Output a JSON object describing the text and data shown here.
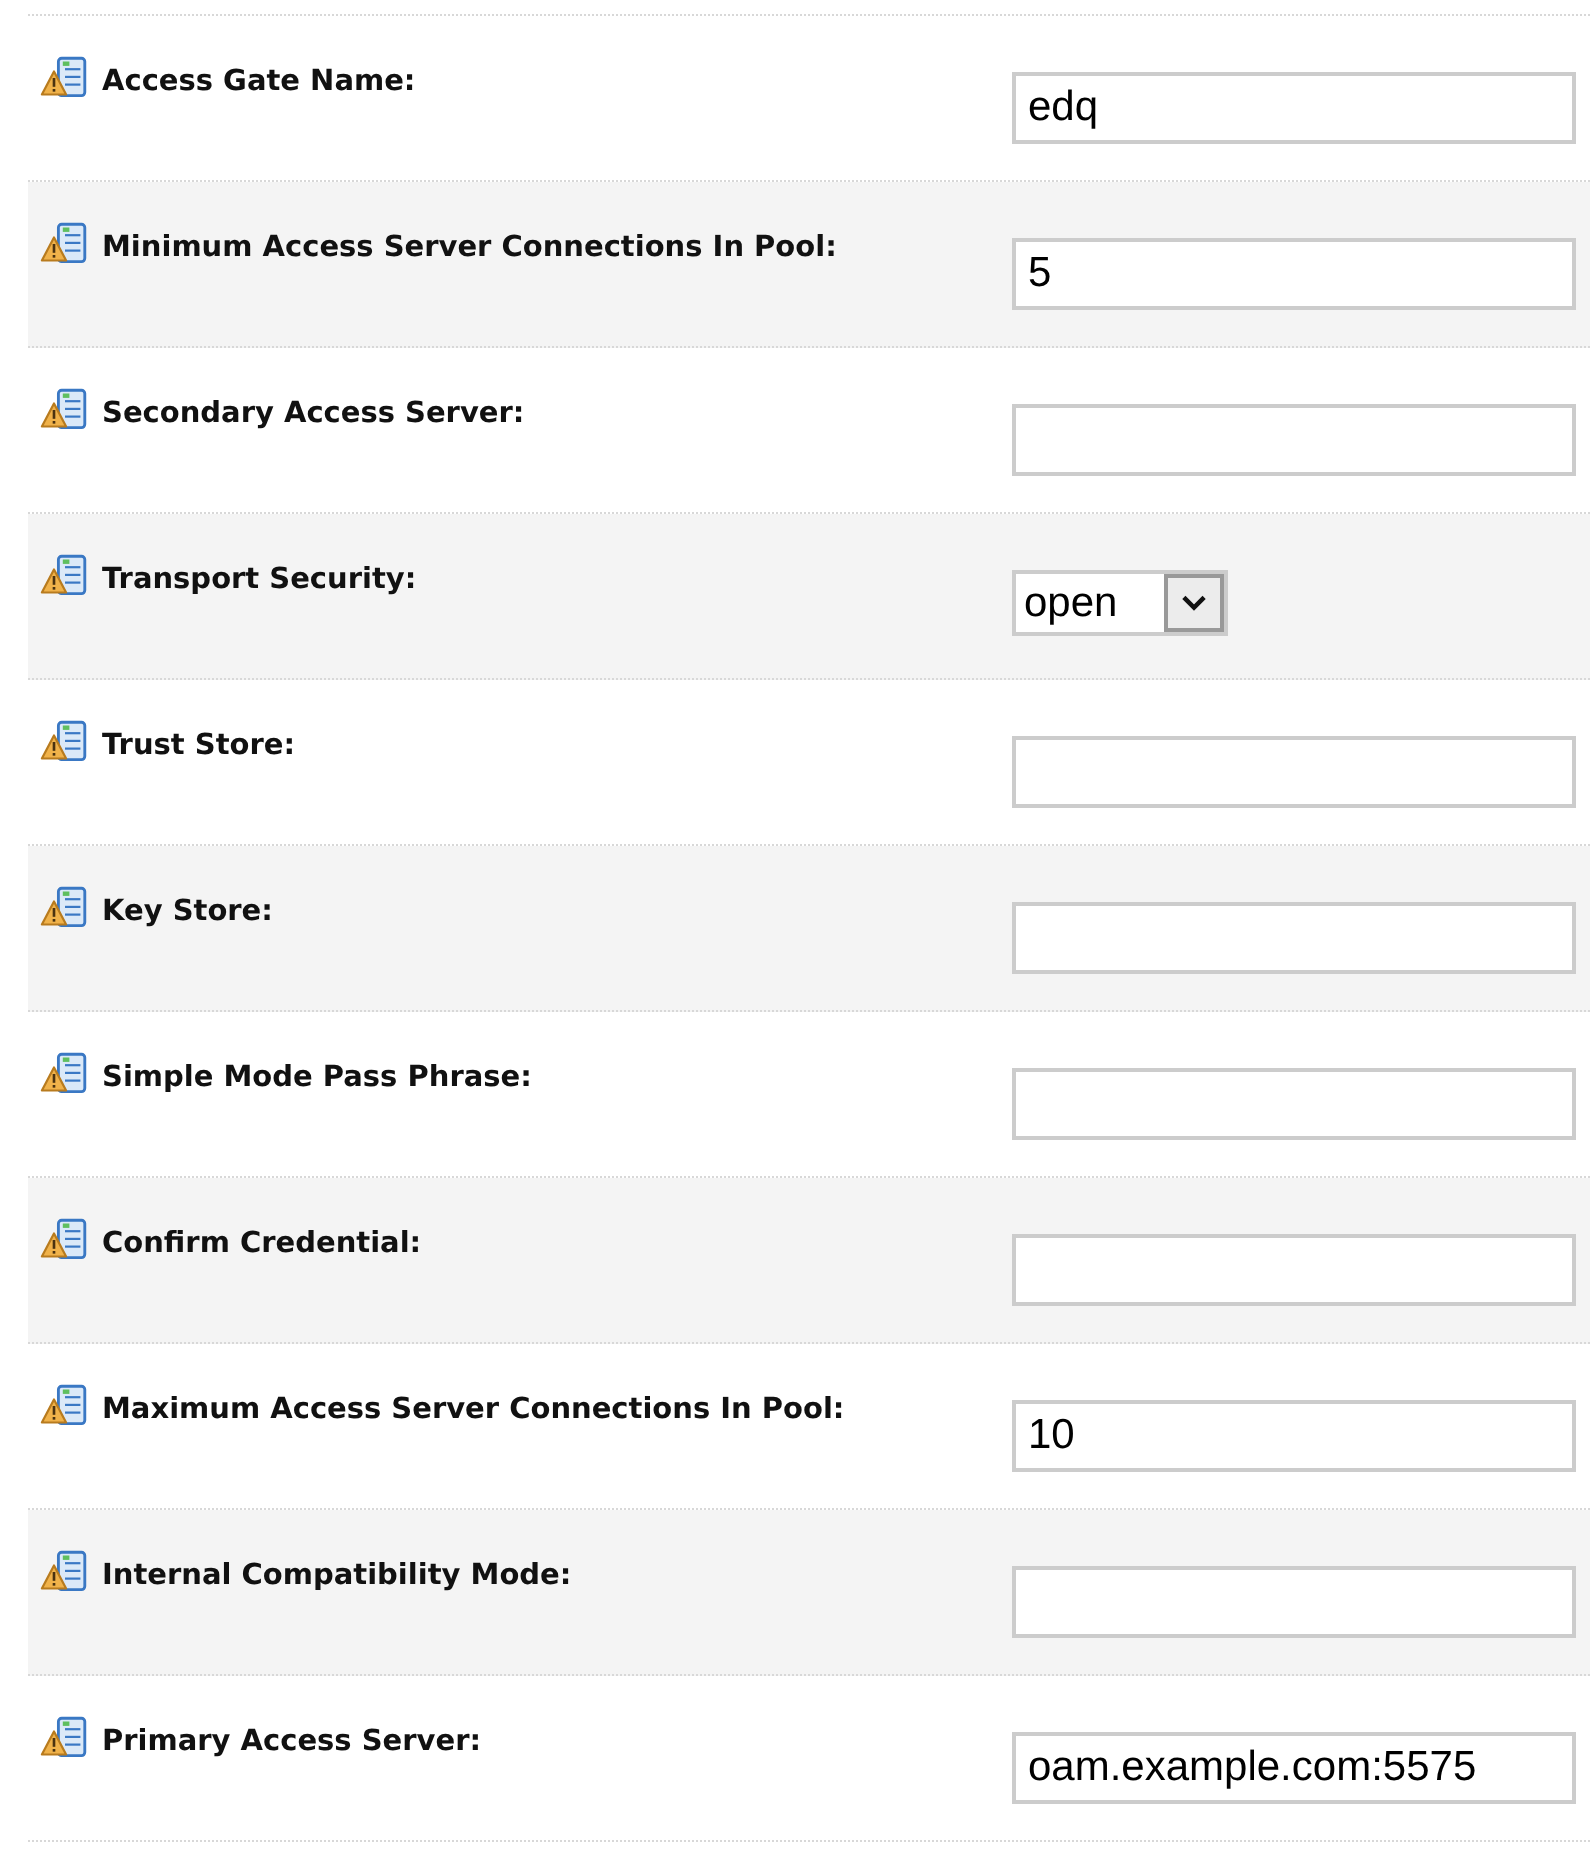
{
  "fields": [
    {
      "label": "Access Gate Name:",
      "kind": "text",
      "value": "edq"
    },
    {
      "label": "Minimum Access Server Connections In Pool:",
      "kind": "text",
      "value": "5"
    },
    {
      "label": "Secondary Access Server:",
      "kind": "text"
    },
    {
      "label": "Transport Security:",
      "kind": "select",
      "value": "open"
    },
    {
      "label": "Trust Store:",
      "kind": "text"
    },
    {
      "label": "Key Store:",
      "kind": "text"
    },
    {
      "label": "Simple Mode Pass Phrase:",
      "kind": "text"
    },
    {
      "label": "Confirm Credential:",
      "kind": "text"
    },
    {
      "label": "Maximum Access Server Connections In Pool:",
      "kind": "text",
      "value": "10"
    },
    {
      "label": "Internal Compatibility Mode:",
      "kind": "text"
    },
    {
      "label": "Primary Access Server:",
      "kind": "text",
      "value": "oam.example.com:5575"
    }
  ]
}
